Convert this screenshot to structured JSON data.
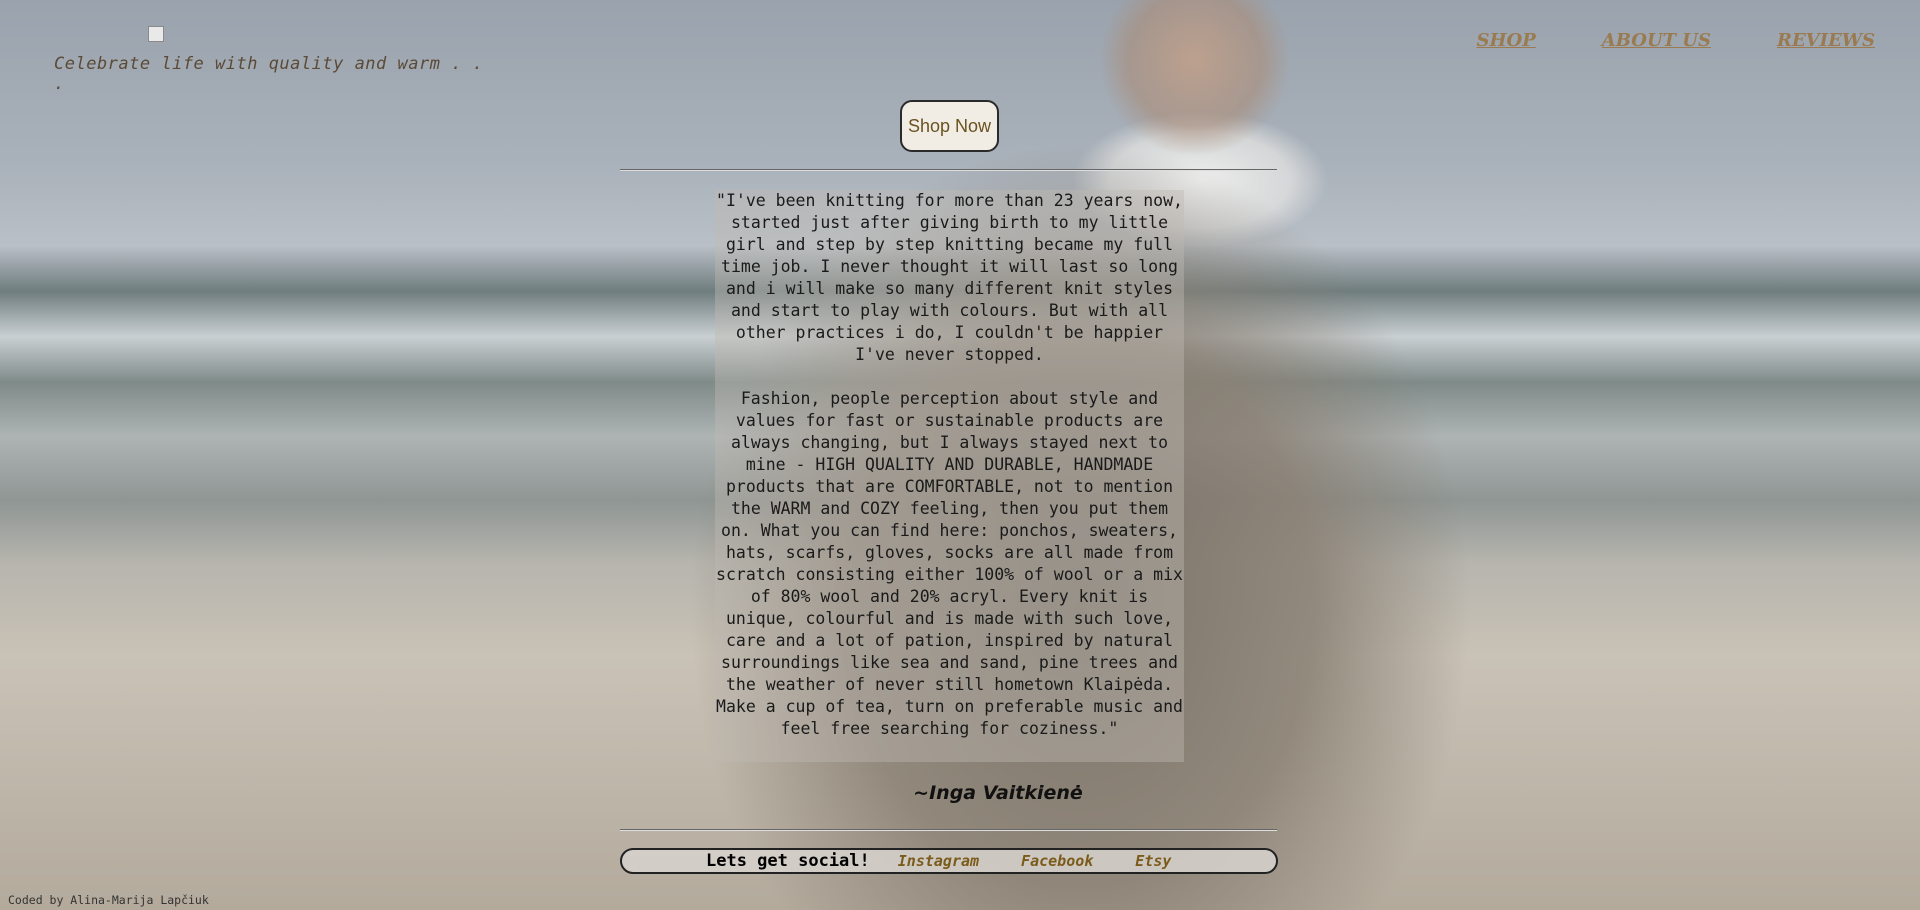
{
  "header": {
    "tagline": "Celebrate life with quality and warm . . ."
  },
  "nav": {
    "items": [
      "SHOP",
      "ABOUT US",
      "REVIEWS"
    ]
  },
  "hero": {
    "shop_now_label": "Shop Now"
  },
  "quote": {
    "paragraph1": "\"I've been knitting for more than 23 years now, started just after giving birth to my little girl and step by step knitting became my full time job. I never thought it will last so long and i will make so many different knit styles and start to play with colours. But with all other practices i do, I couldn't be happier I've never stopped.",
    "paragraph2": "Fashion, people perception about style and values for fast or sustainable products are always changing, but I always stayed next to mine - HIGH QUALITY AND DURABLE, HANDMADE products that are COMFORTABLE, not to mention the WARM and COZY feeling, then you put them on. What you can find here: ponchos, sweaters, hats, scarfs, gloves, socks are all made from scratch consisting either 100% of wool or a mix of 80% wool and 20% acryl. Every knit is unique, colourful and is made with such love, care and a lot of pation, inspired by natural surroundings like sea and sand, pine trees and the weather of never still hometown Klaipėda. Make a cup of tea, turn on preferable music and feel free searching for coziness.\"",
    "signature": "~Inga Vaitkienė"
  },
  "social": {
    "label": "Lets get social!",
    "links": [
      "Instagram",
      "Facebook",
      "Etsy"
    ]
  },
  "footer": {
    "credit": "Coded by Alina-Marija Lapčiuk"
  },
  "icons": {
    "logo": "broken-image-icon"
  },
  "colors": {
    "nav_link": "#9a7a50",
    "social_link": "#7a5b1a",
    "tagline": "#5b4a37",
    "button_bg": "#f2ede4"
  }
}
